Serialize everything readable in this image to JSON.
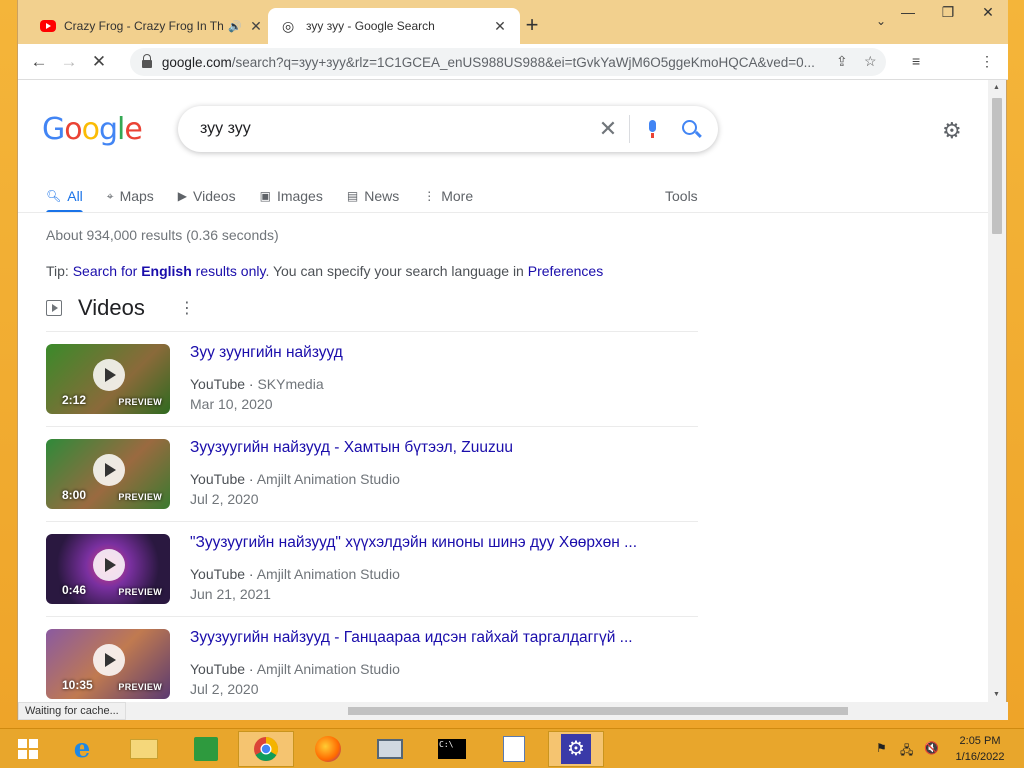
{
  "browser": {
    "tabs": [
      {
        "title": "Crazy Frog - Crazy Frog In Th",
        "active": false
      },
      {
        "title": "зуу зуу - Google Search",
        "active": true
      }
    ],
    "url_domain": "google.com",
    "url_rest": "/search?q=зуу+зуу&rlz=1C1GCEA_enUS988US988&ei=tGvkYaWjM6O5ggeKmoHQCA&ved=0...",
    "status": "Waiting for cache..."
  },
  "google": {
    "query": "зуу зуу",
    "tabs": [
      {
        "label": "All",
        "icon": "search-icon"
      },
      {
        "label": "Maps",
        "icon": "map-pin-icon"
      },
      {
        "label": "Videos",
        "icon": "video-icon"
      },
      {
        "label": "Images",
        "icon": "image-icon"
      },
      {
        "label": "News",
        "icon": "news-icon"
      },
      {
        "label": "More",
        "icon": "more-vert-icon"
      }
    ],
    "tools_label": "Tools",
    "stats": "About 934,000 results (0.36 seconds)",
    "tip": {
      "prefix": "Tip: ",
      "link1": "Search for ",
      "bold": "English",
      "link1_end": " results only",
      "middle": ". You can specify your search language in ",
      "link2": "Preferences"
    },
    "videos_heading": "Videos",
    "videos": [
      {
        "title": "Зуу зуунгийн найзууд",
        "source": "YouTube",
        "channel": "SKYmedia",
        "date": "Mar 10, 2020",
        "duration": "2:12",
        "preview": "PREVIEW",
        "color": "#4a7a30"
      },
      {
        "title": "Зуузуугийн найзууд - Хамтын бүтээл, Zuuzuu",
        "source": "YouTube",
        "channel": "Amjilt Animation Studio",
        "date": "Jul 2, 2020",
        "duration": "8:00",
        "preview": "PREVIEW",
        "color": "#6a5030"
      },
      {
        "title": "\"Зуузуугийн найзууд\" хүүхэлдэйн киноны шинэ дуу Хөөрхөн ...",
        "source": "YouTube",
        "channel": "Amjilt Animation Studio",
        "date": "Jun 21, 2021",
        "duration": "0:46",
        "preview": "PREVIEW",
        "color": "#3a2050"
      },
      {
        "title": "Зуузуугийн найзууд - Ганцаараа идсэн гайхай таргалдаггүй ...",
        "source": "YouTube",
        "channel": "Amjilt Animation Studio",
        "date": "Jul 2, 2020",
        "duration": "10:35",
        "preview": "PREVIEW",
        "color": "#6a3a70"
      }
    ]
  },
  "taskbar": {
    "time": "2:05 PM",
    "date": "1/16/2022"
  }
}
